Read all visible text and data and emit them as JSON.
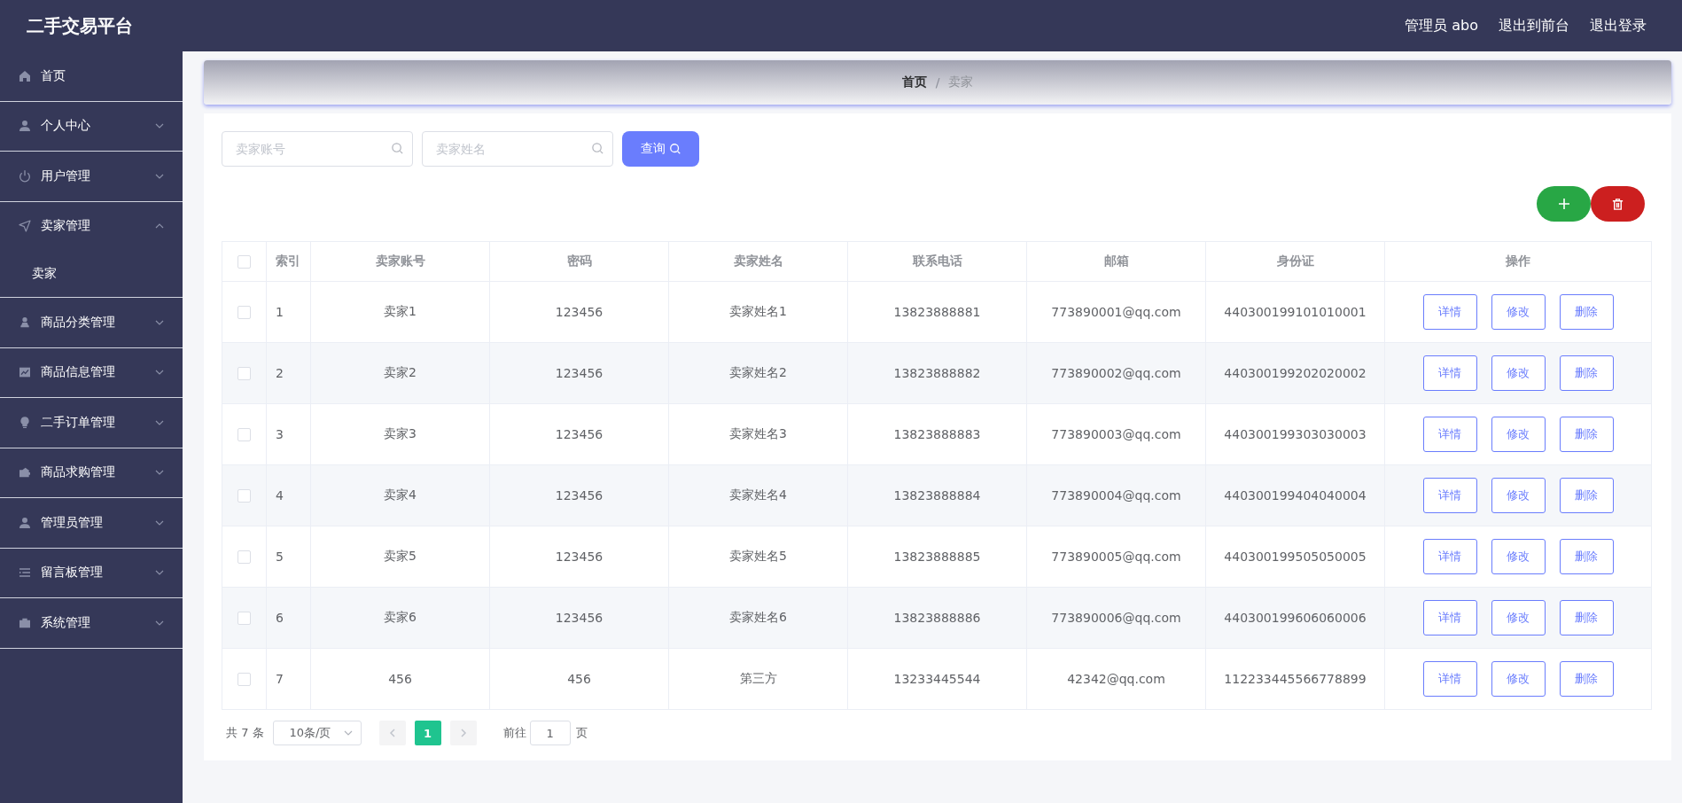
{
  "header": {
    "title": "二手交易平台",
    "links": [
      "管理员 abo",
      "退出到前台",
      "退出登录"
    ]
  },
  "sidebar": {
    "items": [
      {
        "label": "首页",
        "kind": "link"
      },
      {
        "label": "个人中心",
        "kind": "submenu",
        "expanded": false
      },
      {
        "label": "用户管理",
        "kind": "submenu",
        "expanded": false
      },
      {
        "label": "卖家管理",
        "kind": "submenu",
        "expanded": true,
        "children": [
          {
            "label": "卖家"
          }
        ]
      },
      {
        "label": "商品分类管理",
        "kind": "submenu",
        "expanded": false
      },
      {
        "label": "商品信息管理",
        "kind": "submenu",
        "expanded": false
      },
      {
        "label": "二手订单管理",
        "kind": "submenu",
        "expanded": false
      },
      {
        "label": "商品求购管理",
        "kind": "submenu",
        "expanded": false
      },
      {
        "label": "管理员管理",
        "kind": "submenu",
        "expanded": false
      },
      {
        "label": "留言板管理",
        "kind": "submenu",
        "expanded": false
      },
      {
        "label": "系统管理",
        "kind": "submenu",
        "expanded": false
      }
    ]
  },
  "breadcrumb": {
    "separator": "/",
    "items": [
      "首页",
      "卖家"
    ]
  },
  "search": {
    "fields": [
      {
        "placeholder": "卖家账号"
      },
      {
        "placeholder": "卖家姓名"
      }
    ],
    "button": "查询"
  },
  "table": {
    "header_checked": false,
    "columns": [
      "索引",
      "卖家账号",
      "密码",
      "卖家姓名",
      "联系电话",
      "邮箱",
      "身份证",
      "操作"
    ],
    "rows": [
      {
        "checked": false,
        "cells": [
          "1",
          "卖家1",
          "123456",
          "卖家姓名1",
          "13823888881",
          "773890001@qq.com",
          "440300199101010001"
        ],
        "actions": [
          "详情",
          "修改",
          "删除"
        ]
      },
      {
        "checked": false,
        "cells": [
          "2",
          "卖家2",
          "123456",
          "卖家姓名2",
          "13823888882",
          "773890002@qq.com",
          "440300199202020002"
        ],
        "actions": [
          "详情",
          "修改",
          "删除"
        ]
      },
      {
        "checked": false,
        "cells": [
          "3",
          "卖家3",
          "123456",
          "卖家姓名3",
          "13823888883",
          "773890003@qq.com",
          "440300199303030003"
        ],
        "actions": [
          "详情",
          "修改",
          "删除"
        ]
      },
      {
        "checked": false,
        "cells": [
          "4",
          "卖家4",
          "123456",
          "卖家姓名4",
          "13823888884",
          "773890004@qq.com",
          "440300199404040004"
        ],
        "actions": [
          "详情",
          "修改",
          "删除"
        ]
      },
      {
        "checked": false,
        "cells": [
          "5",
          "卖家5",
          "123456",
          "卖家姓名5",
          "13823888885",
          "773890005@qq.com",
          "440300199505050005"
        ],
        "actions": [
          "详情",
          "修改",
          "删除"
        ]
      },
      {
        "checked": false,
        "cells": [
          "6",
          "卖家6",
          "123456",
          "卖家姓名6",
          "13823888886",
          "773890006@qq.com",
          "440300199606060006"
        ],
        "actions": [
          "详情",
          "修改",
          "删除"
        ]
      },
      {
        "checked": false,
        "cells": [
          "7",
          "456",
          "456",
          "第三方",
          "13233445544",
          "42342@qq.com",
          "112233445566778899"
        ],
        "actions": [
          "详情",
          "修改",
          "删除"
        ]
      }
    ]
  },
  "pagination": {
    "total": "共 7 条",
    "page_size": "10条/页",
    "pages": [
      {
        "label": "1",
        "selected": true
      }
    ],
    "goto_label": "前往",
    "goto_value": "1",
    "goto_suffix": "页"
  }
}
